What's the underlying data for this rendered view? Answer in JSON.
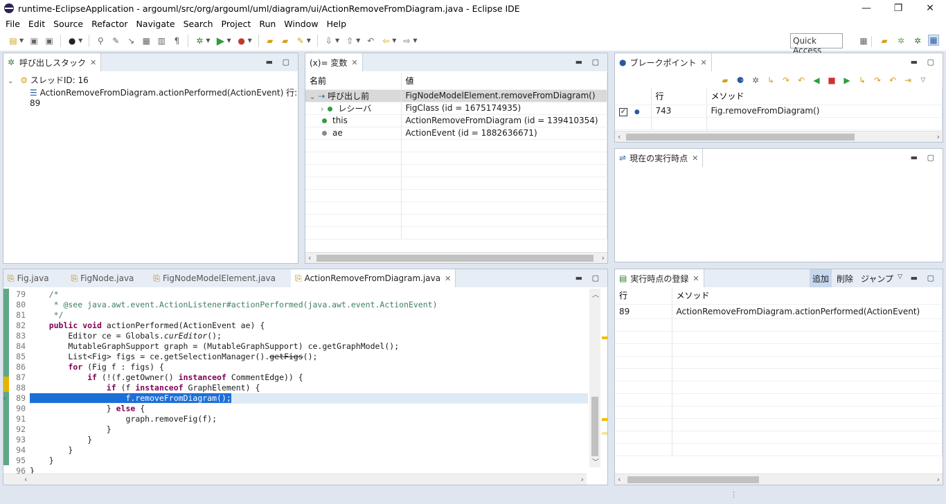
{
  "window": {
    "title": "runtime-EclipseApplication - argouml/src/org/argouml/uml/diagram/ui/ActionRemoveFromDiagram.java - Eclipse IDE",
    "min": "—",
    "restore": "❐",
    "close": "✕"
  },
  "menu": [
    "File",
    "Edit",
    "Source",
    "Refactor",
    "Navigate",
    "Search",
    "Project",
    "Run",
    "Window",
    "Help"
  ],
  "toolbar": {
    "quick_access": "Quick Access"
  },
  "callstack": {
    "tab": "呼び出しスタック",
    "thread": "スレッドID: 16",
    "frame": "ActionRemoveFromDiagram.actionPerformed(ActionEvent) 行: 89"
  },
  "variables": {
    "tab": "(x)= 変数",
    "col_name": "名前",
    "col_value": "値",
    "rows": [
      {
        "name": "呼び出し前",
        "value": "FigNodeModelElement.removeFromDiagram()"
      },
      {
        "name": "レシーバ",
        "value": "FigClass (id = 1675174935)"
      },
      {
        "name": "this",
        "value": "ActionRemoveFromDiagram (id = 139410354)"
      },
      {
        "name": "ae",
        "value": "ActionEvent (id = 1882636671)"
      }
    ]
  },
  "breakpoints": {
    "tab": "ブレークポイント",
    "col_line": "行",
    "col_method": "メソッド",
    "rows": [
      {
        "checked": true,
        "line": "743",
        "method": "Fig.removeFromDiagram()"
      }
    ]
  },
  "current_point": {
    "tab": "現在の実行時点"
  },
  "editor": {
    "tabs": [
      "Fig.java",
      "FigNode.java",
      "FigNodeModelElement.java",
      "ActionRemoveFromDiagram.java"
    ],
    "active_tab": "ActionRemoveFromDiagram.java",
    "lines": [
      {
        "n": "79",
        "text": "    /*"
      },
      {
        "n": "80",
        "text": "     * @see java.awt.event.ActionListener#actionPerformed(java.awt.event.ActionEvent)"
      },
      {
        "n": "81",
        "text": "     */"
      },
      {
        "n": "82",
        "text": "    public void actionPerformed(ActionEvent ae) {"
      },
      {
        "n": "83",
        "text": "        Editor ce = Globals.curEditor();"
      },
      {
        "n": "84",
        "text": "        MutableGraphSupport graph = (MutableGraphSupport) ce.getGraphModel();"
      },
      {
        "n": "85",
        "text": "        List<Fig> figs = ce.getSelectionManager().getFigs();"
      },
      {
        "n": "86",
        "text": "        for (Fig f : figs) {"
      },
      {
        "n": "87",
        "text": "            if (!(f.getOwner() instanceof CommentEdge)) {"
      },
      {
        "n": "88",
        "text": "                if (f instanceof GraphElement) {"
      },
      {
        "n": "89",
        "text": "                    f.removeFromDiagram();"
      },
      {
        "n": "90",
        "text": "                } else {"
      },
      {
        "n": "91",
        "text": "                    graph.removeFig(f);"
      },
      {
        "n": "92",
        "text": "                }"
      },
      {
        "n": "93",
        "text": "            }"
      },
      {
        "n": "94",
        "text": "        }"
      },
      {
        "n": "95",
        "text": "    }"
      },
      {
        "n": "96",
        "text": "}"
      }
    ]
  },
  "exec_log": {
    "tab": "実行時点の登録",
    "actions": [
      "追加",
      "削除",
      "ジャンプ"
    ],
    "col_line": "行",
    "col_method": "メソッド",
    "rows": [
      {
        "line": "89",
        "method": "ActionRemoveFromDiagram.actionPerformed(ActionEvent)"
      }
    ]
  }
}
